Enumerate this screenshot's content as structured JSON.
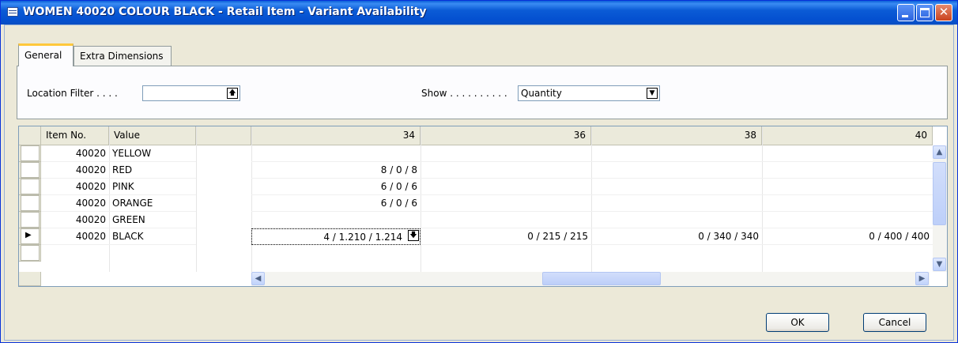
{
  "window": {
    "title": "WOMEN 40020 COLOUR BLACK - Retail Item - Variant Availability",
    "controls": [
      "minimize",
      "maximize",
      "close"
    ]
  },
  "tabs": [
    {
      "label": "General",
      "active": true
    },
    {
      "label": "Extra Dimensions",
      "active": false
    }
  ],
  "filters": {
    "location_label": "Location Filter . . . .",
    "location_value": "",
    "show_label": "Show . . . . . . . . . .",
    "show_value": "Quantity"
  },
  "grid": {
    "columns": {
      "item_no": "Item No.",
      "value": "Value"
    },
    "size_columns": [
      "34",
      "36",
      "38",
      "40"
    ],
    "rows": [
      {
        "item_no": "40020",
        "value": "YELLOW",
        "cells": [
          "",
          "",
          "",
          ""
        ],
        "current": false
      },
      {
        "item_no": "40020",
        "value": "RED",
        "cells": [
          "8 / 0 / 8",
          "",
          "",
          ""
        ],
        "current": false
      },
      {
        "item_no": "40020",
        "value": "PINK",
        "cells": [
          "6 / 0 / 6",
          "",
          "",
          ""
        ],
        "current": false
      },
      {
        "item_no": "40020",
        "value": "ORANGE",
        "cells": [
          "6 / 0 / 6",
          "",
          "",
          ""
        ],
        "current": false
      },
      {
        "item_no": "40020",
        "value": "GREEN",
        "cells": [
          "",
          "",
          "",
          ""
        ],
        "current": false
      },
      {
        "item_no": "40020",
        "value": "BLACK",
        "cells": [
          "4 / 1.210 / 1.214",
          "0 / 215 / 215",
          "0 / 340 / 340",
          "0 / 400 / 400"
        ],
        "current": true
      }
    ],
    "current_row_marker": "▶"
  },
  "buttons": {
    "ok": "OK",
    "cancel": "Cancel"
  },
  "colors": {
    "title_bar": "#0a5fd8",
    "close_button": "#c9421f",
    "active_tab_accent": "#ffc83c",
    "dialog_bg": "#ece9d8"
  }
}
